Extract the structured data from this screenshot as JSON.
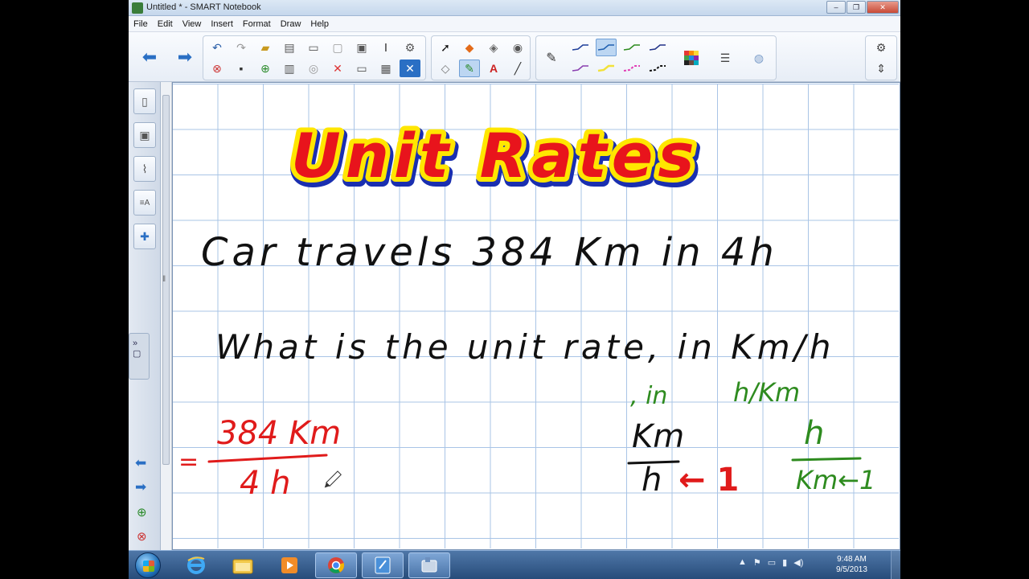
{
  "window": {
    "title": "Untitled * - SMART Notebook",
    "minimize": "–",
    "restore": "❐",
    "close": "✕"
  },
  "menu": [
    "File",
    "Edit",
    "View",
    "Insert",
    "Format",
    "Draw",
    "Help"
  ],
  "toolbar": {
    "back_icon": "arrow-left-icon",
    "forward_icon": "arrow-right-icon",
    "accent": "#2a6fc4",
    "text_tool_label": "A"
  },
  "canvas": {
    "title": "Unit Rates",
    "line1": "Car travels 384 Km in 4h",
    "line2": "What is the unit rate, in Km/h",
    "aside_in": ", in",
    "aside_unit": "h/Km",
    "equals": "=",
    "fraction_num": "384 Km",
    "fraction_den": "4 h",
    "unit_km": "Km",
    "unit_h": "h",
    "arrow1": "← 1",
    "green_h": "h",
    "green_km1": "Km←1",
    "colors": {
      "title_fill": "#e8141c",
      "title_outline": "#ffe600",
      "title_shadow": "#1a2fb0",
      "ink_black": "#111111",
      "ink_red": "#e01b1b",
      "ink_green": "#2e8b1f",
      "grid": "#a9c4e6"
    }
  },
  "taskbar": {
    "time": "9:48 AM",
    "date": "9/5/2013"
  }
}
